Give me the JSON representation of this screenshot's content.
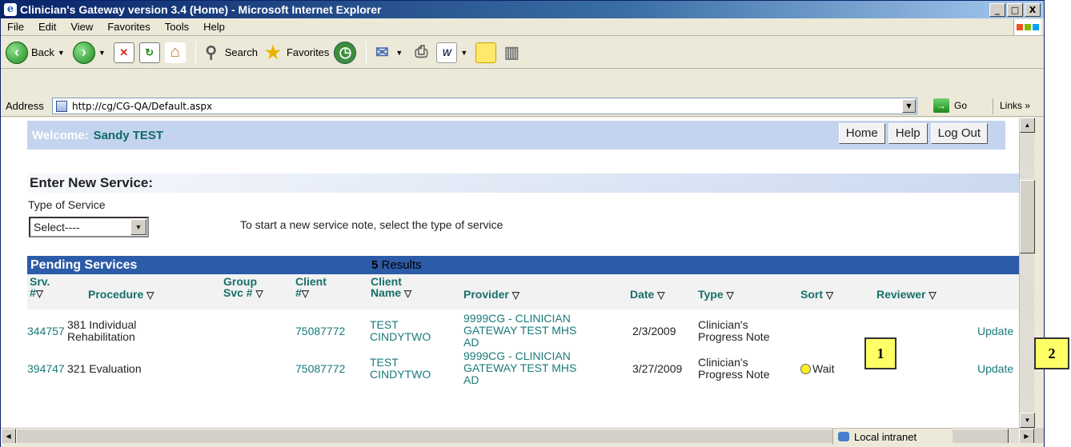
{
  "window": {
    "title": "Clinician's Gateway version 3.4 (Home) - Microsoft Internet Explorer",
    "controls": [
      "_",
      "□",
      "X"
    ]
  },
  "menu": [
    "File",
    "Edit",
    "View",
    "Favorites",
    "Tools",
    "Help"
  ],
  "toolbar": {
    "back_label": "Back",
    "search_label": "Search",
    "favorites_label": "Favorites"
  },
  "address": {
    "label": "Address",
    "url": "http://cg/CG-QA/Default.aspx",
    "go_label": "Go",
    "links_label": "Links »"
  },
  "page": {
    "welcome_label": "Welcome:",
    "user_name": "Sandy TEST",
    "nav": {
      "home": "Home",
      "help": "Help",
      "logout": "Log Out"
    },
    "new_service": {
      "header": "Enter New Service:",
      "type_label": "Type of Service",
      "select_value": "Select----",
      "hint": "To start a new service note, select the type of service"
    },
    "pending": {
      "header": "Pending Services",
      "results_count": "5",
      "results_label": "Results",
      "columns": {
        "srv_line1": "Srv.",
        "srv_line2": "#",
        "procedure": "Procedure",
        "group_line1": "Group",
        "group_line2": "Svc #",
        "client_line1": "Client",
        "client_line2": "#",
        "clientname_line1": "Client",
        "clientname_line2": "Name",
        "provider": "Provider",
        "date": "Date",
        "type": "Type",
        "sort": "Sort",
        "reviewer": "Reviewer"
      },
      "rows": [
        {
          "srv": "344757",
          "procedure_l1": "381 Individual",
          "procedure_l2": "Rehabilitation",
          "client": "75087772",
          "name_l1": "TEST",
          "name_l2": "CINDYTWO",
          "provider_l1": "9999CG - CLINICIAN",
          "provider_l2": "GATEWAY TEST MHS",
          "provider_l3": "AD",
          "date": "2/3/2009",
          "type_l1": "Clinician's",
          "type_l2": "Progress Note",
          "sort": "",
          "action": "Update"
        },
        {
          "srv": "394747",
          "procedure_l1": "321 Evaluation",
          "procedure_l2": "",
          "client": "75087772",
          "name_l1": "TEST",
          "name_l2": "CINDYTWO",
          "provider_l1": "9999CG - CLINICIAN",
          "provider_l2": "GATEWAY TEST MHS",
          "provider_l3": "AD",
          "date": "3/27/2009",
          "type_l1": "Clinician's",
          "type_l2": "Progress Note",
          "sort": "Wait",
          "action": "Update"
        }
      ]
    }
  },
  "status": {
    "zone": "Local intranet"
  },
  "callouts": [
    "1",
    "2"
  ],
  "colors": {
    "accent": "#2c5ba8",
    "link": "#1a7a7a",
    "callout": "#ffff66"
  }
}
